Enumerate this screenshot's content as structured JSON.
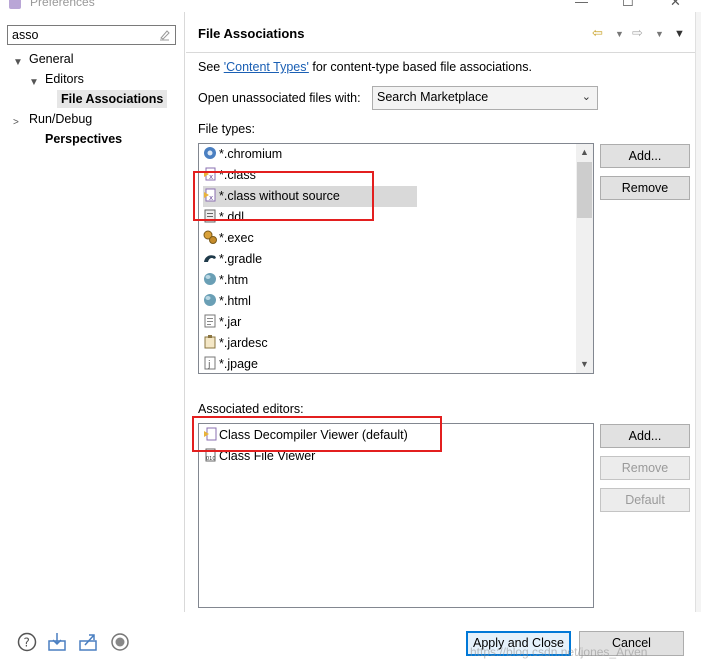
{
  "window": {
    "title": "Preferences"
  },
  "filter": {
    "value": "asso"
  },
  "tree": {
    "general": "General",
    "editors": "Editors",
    "file_associations": "File Associations",
    "run_debug": "Run/Debug",
    "perspectives": "Perspectives"
  },
  "page": {
    "title": "File Associations",
    "see_prefix": "See ",
    "content_types_link": "'Content Types'",
    "see_suffix": " for content-type based file associations.",
    "open_label": "Open unassociated files with:",
    "open_value": "Search Marketplace",
    "file_types_label": "File types:",
    "associated_editors_label": "Associated editors:"
  },
  "file_types": [
    {
      "label": "*.chromium",
      "icon": "chromium-icon"
    },
    {
      "label": "*.class",
      "icon": "class-file-icon"
    },
    {
      "label": "*.class without source",
      "icon": "class-file-icon"
    },
    {
      "label": "*.ddl",
      "icon": "ddl-file-icon"
    },
    {
      "label": "*.exec",
      "icon": "exec-file-icon"
    },
    {
      "label": "*.gradle",
      "icon": "gradle-icon"
    },
    {
      "label": "*.htm",
      "icon": "globe-icon"
    },
    {
      "label": "*.html",
      "icon": "globe-icon"
    },
    {
      "label": "*.jar",
      "icon": "text-file-icon"
    },
    {
      "label": "*.jardesc",
      "icon": "jardesc-icon"
    },
    {
      "label": "*.jpage",
      "icon": "jpage-icon"
    }
  ],
  "editors": [
    {
      "label": "Class Decompiler Viewer (default)",
      "icon": "decompiler-icon"
    },
    {
      "label": "Class File Viewer",
      "icon": "class-viewer-icon"
    }
  ],
  "buttons": {
    "add": "Add...",
    "remove": "Remove",
    "default": "Default",
    "apply_close": "Apply and Close",
    "cancel": "Cancel"
  },
  "watermark": "https://blog.csdn.net/jones_Arven",
  "colors": {
    "highlight_box": "#e31f1f",
    "link": "#1a5fb4",
    "selection": "#d9d9d9"
  }
}
